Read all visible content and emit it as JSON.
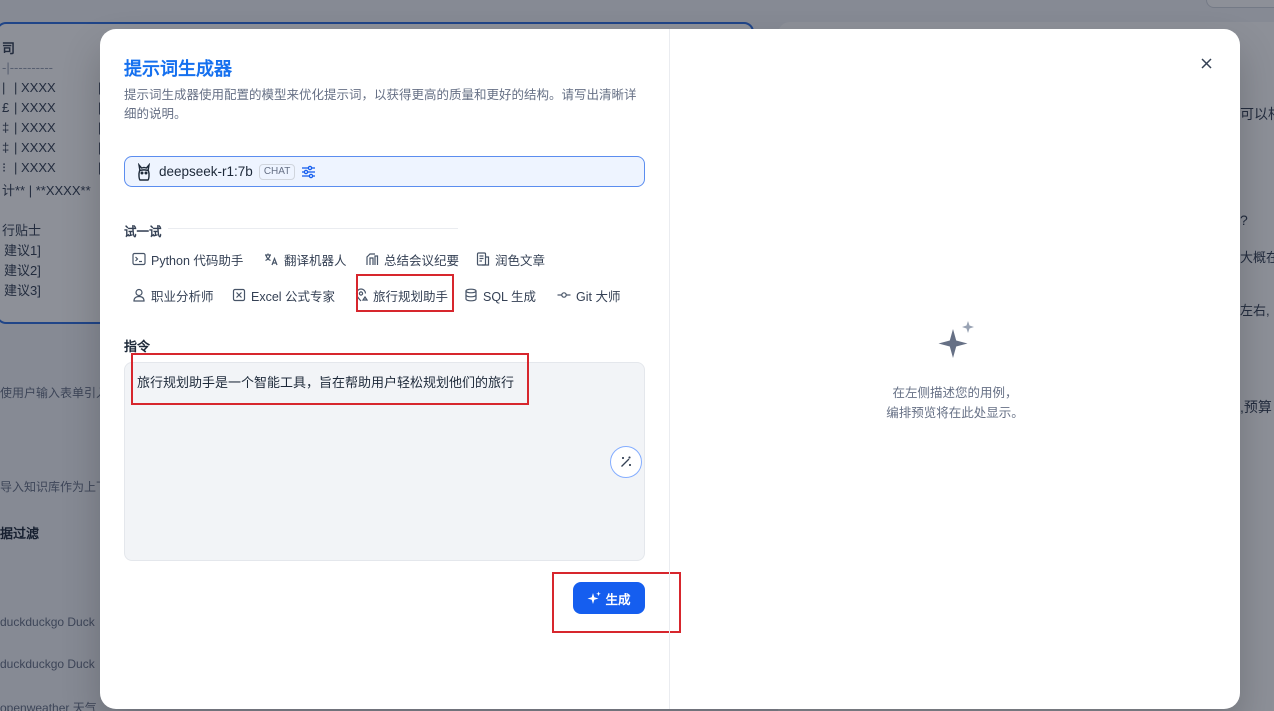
{
  "background": {
    "table_rows": [
      {
        "left": "|",
        "mid": "| XXXX",
        "right": "|"
      },
      {
        "left": "£",
        "mid": "| XXXX",
        "right": "|"
      },
      {
        "left": "‡",
        "mid": "| XXXX",
        "right": "|"
      },
      {
        "left": "‡",
        "mid": "| XXXX",
        "right": "|"
      },
      {
        "left": "⁝",
        "mid": "| XXXX",
        "right": "|"
      }
    ],
    "header_fragment": "司",
    "separator_fragment": "-|----------",
    "total_row": "计** | **XXXX**",
    "tips_title": "行贴士",
    "tips": [
      "建议1]",
      "建议2]",
      "建议3]"
    ],
    "sections": [
      "使用户输入表单引入",
      "导入知识库作为上下",
      "据过滤",
      "duckduckgo  Duck",
      "duckduckgo  Duck",
      "openweather  天气"
    ],
    "right_fragments": [
      "可以相",
      "?",
      "大概在",
      "左右,",
      ",预算"
    ]
  },
  "modal": {
    "title": "提示词生成器",
    "description": "提示词生成器使用配置的模型来优化提示词，以获得更高的质量和更好的结构。请写出清晰详细的说明。",
    "model": {
      "name": "deepseek-r1:7b",
      "badge": "CHAT"
    },
    "try_label": "试一试",
    "templates": [
      {
        "label": "Python 代码助手",
        "icon": "terminal-icon"
      },
      {
        "label": "翻译机器人",
        "icon": "translate-icon"
      },
      {
        "label": "总结会议纪要",
        "icon": "summary-icon"
      },
      {
        "label": "润色文章",
        "icon": "document-icon"
      },
      {
        "label": "职业分析师",
        "icon": "user-icon"
      },
      {
        "label": "Excel 公式专家",
        "icon": "excel-icon"
      },
      {
        "label": "旅行规划助手",
        "icon": "map-pin-icon"
      },
      {
        "label": "SQL 生成",
        "icon": "database-icon"
      },
      {
        "label": "Git 大师",
        "icon": "git-commit-icon"
      }
    ],
    "instruction_label": "指令",
    "instruction_value": "旅行规划助手是一个智能工具，旨在帮助用户轻松规划他们的旅行",
    "generate_label": "生成",
    "empty_state": {
      "line1": "在左侧描述您的用例，",
      "line2": "编排预览将在此处显示。"
    }
  },
  "colors": {
    "accent": "#155eef",
    "title": "#1570ef",
    "highlight": "#d7262d"
  }
}
